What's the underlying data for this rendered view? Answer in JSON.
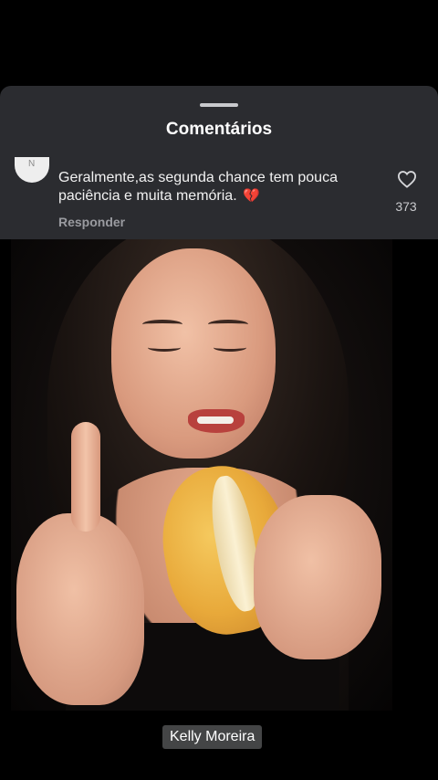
{
  "sheet": {
    "title": "Comentários"
  },
  "comment": {
    "text": "Geralmente,as segunda chance tem pouca paciência e muita memória.",
    "emoji": "💔",
    "reply_label": "Responder",
    "like_count": "373",
    "like_icon": "heart-outline-icon",
    "avatar_letter": "N"
  },
  "video": {
    "username": "Kelly Moreira"
  },
  "colors": {
    "sheet_bg": "#2b2c30",
    "page_bg": "#000000",
    "muted_text": "#9a9ba0",
    "caption_bg": "#444546"
  }
}
